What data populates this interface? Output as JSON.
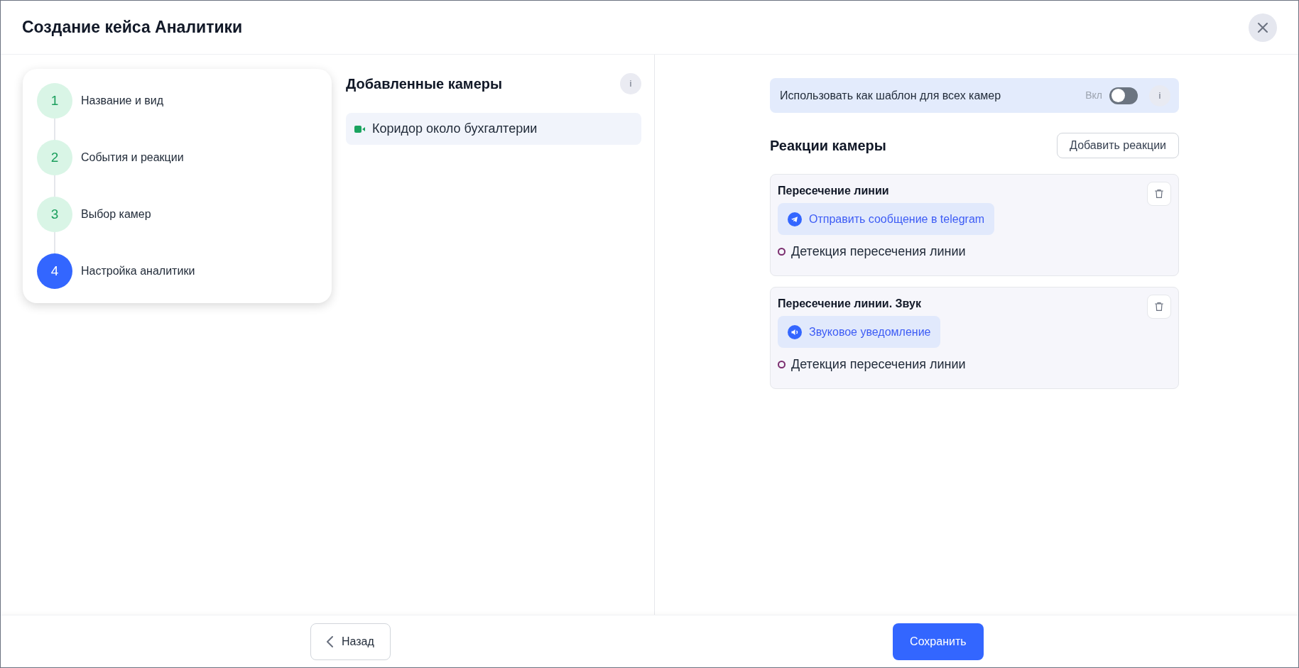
{
  "window": {
    "title": "Создание кейса Аналитики"
  },
  "steps": [
    {
      "number": "1",
      "label": "Название и вид",
      "selected": false
    },
    {
      "number": "2",
      "label": "События и реакции",
      "selected": false
    },
    {
      "number": "3",
      "label": "Выбор камер",
      "selected": false
    },
    {
      "number": "4",
      "label": "Настройка аналитики",
      "selected": true
    }
  ],
  "cameras": {
    "title": "Добавленные камеры",
    "info": "i",
    "items": [
      {
        "name": "Коридор около бухгалтерии",
        "selected": true
      }
    ]
  },
  "template": {
    "label": "Использовать как шаблон для всех камер",
    "toggle_label": "Вкл",
    "on": false,
    "info": "i"
  },
  "reactions": {
    "title": "Реакции камеры",
    "add_button": "Добавить реакции",
    "items": [
      {
        "title": "Пересечение линии",
        "action": {
          "kind": "telegram",
          "label": "Отправить сообщение в telegram"
        },
        "detection": "Детекция пересечения линии"
      },
      {
        "title": "Пересечение линии. Звук",
        "action": {
          "kind": "sound",
          "label": "Звуковое уведомление"
        },
        "detection": "Детекция пересечения линии"
      }
    ]
  },
  "footer": {
    "back": "Назад",
    "save": "Сохранить"
  }
}
